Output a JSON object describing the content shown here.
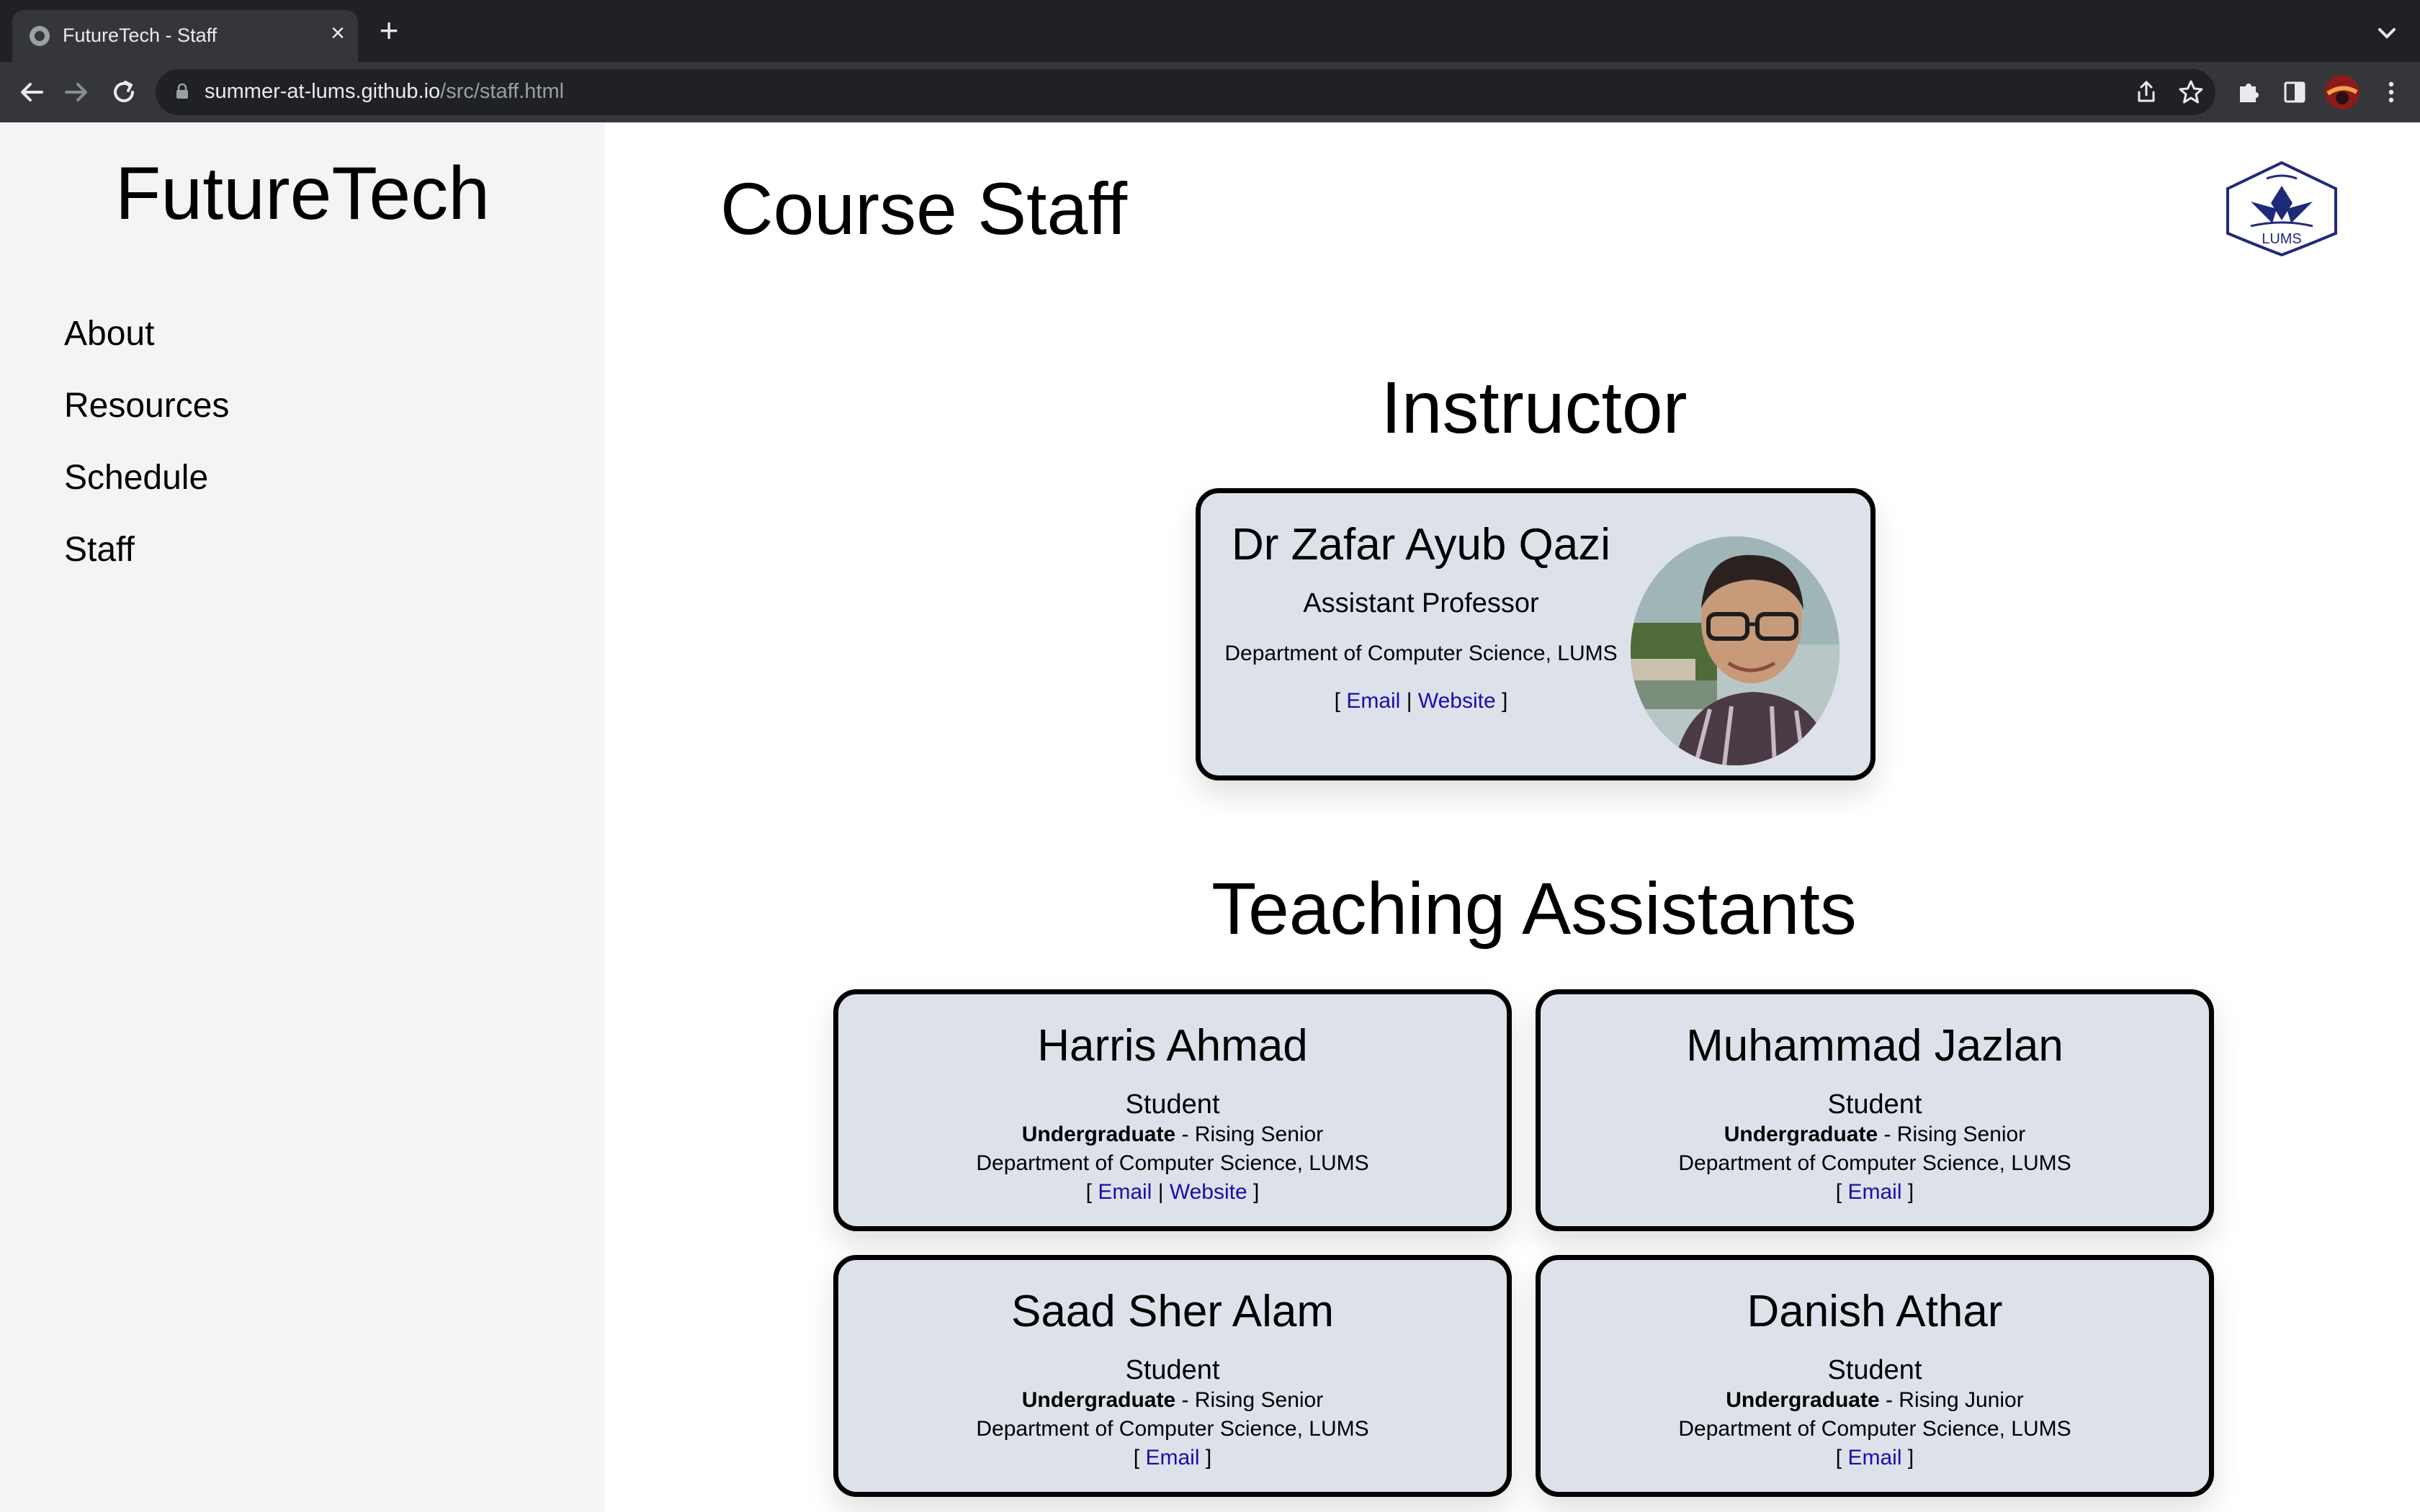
{
  "browser": {
    "tab_title": "FutureTech - Staff",
    "tab_close": "×",
    "new_tab": "+",
    "url_host": "summer-at-lums.github.io",
    "url_path": "/src/staff.html"
  },
  "sidebar": {
    "title": "FutureTech",
    "items": [
      {
        "label": "About"
      },
      {
        "label": "Resources"
      },
      {
        "label": "Schedule"
      },
      {
        "label": "Staff"
      }
    ]
  },
  "main": {
    "page_title": "Course Staff",
    "logo_text": "LUMS",
    "instructor_heading": "Instructor",
    "ta_heading": "Teaching Assistants"
  },
  "instructor": {
    "name": "Dr Zafar Ayub Qazi",
    "title": "Assistant Professor",
    "department": "Department of Computer Science, LUMS",
    "bracket_open": "[",
    "separator": "|",
    "bracket_close": "]",
    "email_label": "Email",
    "website_label": "Website"
  },
  "tas": [
    {
      "name": "Harris Ahmad",
      "role": "Student",
      "level": "Undergraduate",
      "standing": " - Rising Senior",
      "department": "Department of Computer Science, LUMS",
      "email_label": "Email",
      "website_label": "Website"
    },
    {
      "name": "Muhammad Jazlan",
      "role": "Student",
      "level": "Undergraduate",
      "standing": " - Rising Senior",
      "department": "Department of Computer Science, LUMS",
      "email_label": "Email"
    },
    {
      "name": "Saad Sher Alam",
      "role": "Student",
      "level": "Undergraduate",
      "standing": " - Rising Senior",
      "department": "Department of Computer Science, LUMS",
      "email_label": "Email"
    },
    {
      "name": "Danish Athar",
      "role": "Student",
      "level": "Undergraduate",
      "standing": " - Rising Junior",
      "department": "Department of Computer Science, LUMS",
      "email_label": "Email"
    }
  ],
  "colors": {
    "card_bg": "#dde2ea",
    "sidebar_bg": "#f4f4f4",
    "link": "#1a0dab",
    "logo_blue": "#1f2a7a"
  }
}
